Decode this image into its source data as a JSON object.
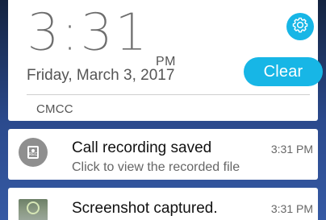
{
  "colors": {
    "accent": "#17b6e6",
    "panel_bg": "#ffffff",
    "wallpaper_top": "#14233f",
    "wallpaper_bottom": "#365aa4"
  },
  "header": {
    "time": "3:31",
    "ampm": "PM",
    "date": "Friday, March 3, 2017",
    "settings_icon": "gear-icon",
    "clear_label": "Clear",
    "carrier": "CMCC"
  },
  "notifications": [
    {
      "icon": "record-icon",
      "title": "Call recording saved",
      "subtitle": "Click to view the recorded file",
      "time": "3:31 PM"
    },
    {
      "icon": "screenshot-thumbnail",
      "title": "Screenshot captured.",
      "time": "3:31 PM"
    }
  ]
}
